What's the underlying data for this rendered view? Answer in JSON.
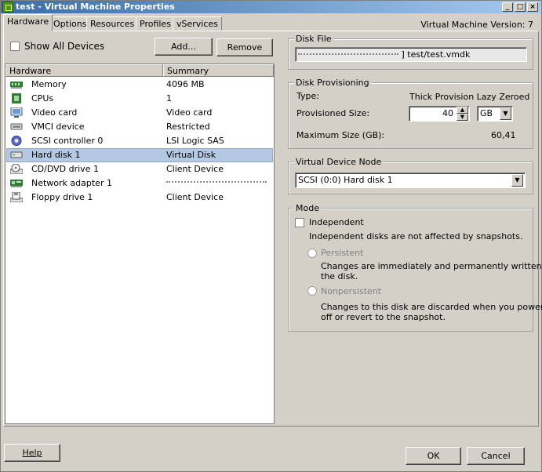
{
  "window": {
    "title": "test - Virtual Machine Properties",
    "version": "Virtual Machine Version: 7"
  },
  "tabs": [
    "Hardware",
    "Options",
    "Resources",
    "Profiles",
    "vServices"
  ],
  "hardware": {
    "show_all_devices": "Show All Devices",
    "add_label": "Add...",
    "remove_label": "Remove",
    "col_hardware": "Hardware",
    "col_summary": "Summary",
    "devices": [
      {
        "name": "Memory",
        "summary": "4096 MB",
        "icon": "memory-icon"
      },
      {
        "name": "CPUs",
        "summary": "1",
        "icon": "cpu-icon"
      },
      {
        "name": "Video card",
        "summary": "Video card",
        "icon": "video-card-icon"
      },
      {
        "name": "VMCI device",
        "summary": "Restricted",
        "icon": "vmci-icon"
      },
      {
        "name": "SCSI controller 0",
        "summary": "LSI Logic SAS",
        "icon": "scsi-controller-icon"
      },
      {
        "name": "Hard disk 1",
        "summary": "Virtual Disk",
        "icon": "hard-disk-icon"
      },
      {
        "name": "CD/DVD drive 1",
        "summary": "Client Device",
        "icon": "cd-dvd-icon"
      },
      {
        "name": "Network adapter 1",
        "summary": "",
        "icon": "network-adapter-icon"
      },
      {
        "name": "Floppy drive 1",
        "summary": "Client Device",
        "icon": "floppy-icon"
      }
    ],
    "selected": "Hard disk 1"
  },
  "disk_file": {
    "title": "Disk File",
    "value": "] test/test.vmdk"
  },
  "disk_provisioning": {
    "title": "Disk Provisioning",
    "type_label": "Type:",
    "type_value": "Thick Provision Lazy Zeroed",
    "prov_size_label": "Provisioned Size:",
    "prov_size_value": "40",
    "unit": "GB",
    "max_size_label": "Maximum Size (GB):",
    "max_size_value": "60,41"
  },
  "virtual_device_node": {
    "title": "Virtual Device Node",
    "value": "SCSI (0:0) Hard disk 1"
  },
  "mode": {
    "title": "Mode",
    "independent_label": "Independent",
    "independent_desc": "Independent disks are not affected by snapshots.",
    "persistent_label": "Persistent",
    "persistent_desc_1": "Changes are immediately and permanently written to",
    "persistent_desc_2": "the disk.",
    "nonpersistent_label": "Nonpersistent",
    "nonpersistent_desc_1": "Changes to this disk are discarded when you power",
    "nonpersistent_desc_2": "off or revert to the snapshot."
  },
  "footer": {
    "help": "Help",
    "ok": "OK",
    "cancel": "Cancel"
  }
}
